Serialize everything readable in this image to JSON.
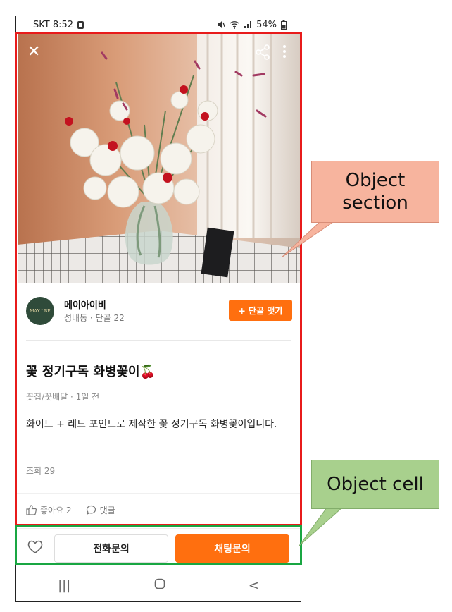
{
  "status_bar": {
    "carrier_time": "SKT 8:52",
    "battery": "54%"
  },
  "seller": {
    "avatar_text": "MAY I BE",
    "name": "메이아이비",
    "sub": "성내동 · 단골 22",
    "follow_label": "+ 단골 맺기"
  },
  "post": {
    "title": "꽃 정기구독 화병꽃이🍒",
    "meta": "꽃집/꽃배달 · 1일 전",
    "description": "화이트 + 레드 포인트로 제작한 꽃 정기구독 화병꽃이입니다.",
    "views": "조회 29",
    "like_label": "좋아요 2",
    "comment_label": "댓글"
  },
  "bottom_bar": {
    "call_label": "전화문의",
    "chat_label": "채팅문의"
  },
  "nav": {
    "recent": "|||",
    "home": "○",
    "back": "<"
  },
  "annotations": {
    "object_section": "Object section",
    "object_cell": "Object cell"
  },
  "colors": {
    "accent": "#ff6f0f",
    "section_box": "#e81b1b",
    "cell_box": "#19a642"
  }
}
